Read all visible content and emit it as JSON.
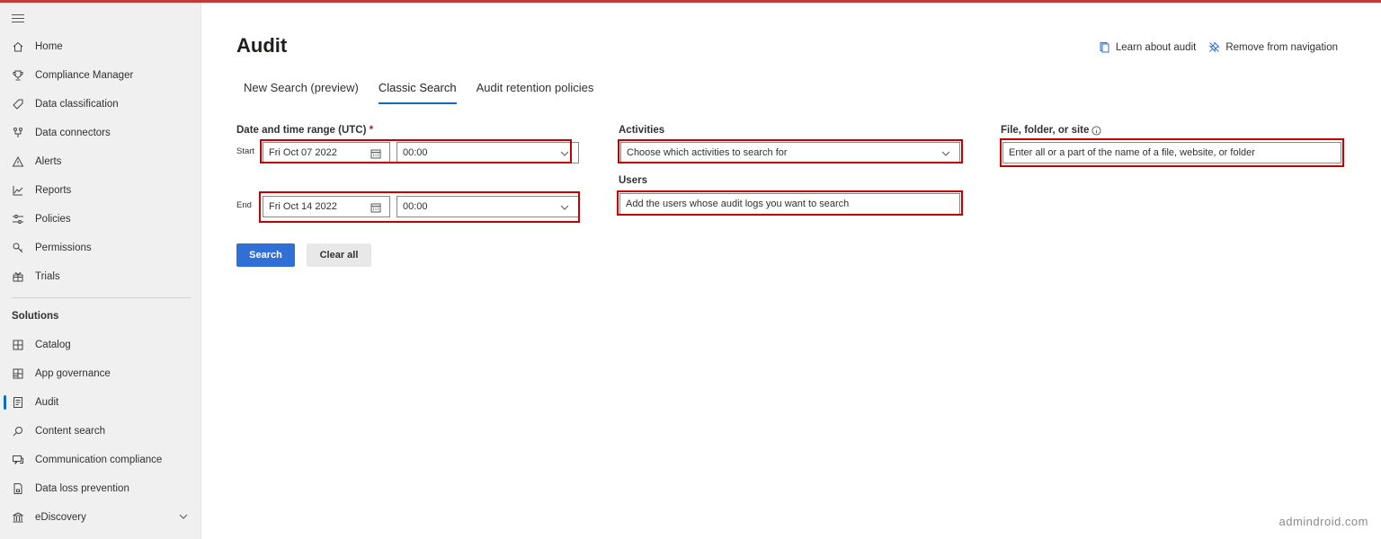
{
  "sidebar": {
    "menu_icon": "hamburger-menu-icon",
    "items": [
      {
        "label": "Home",
        "icon": "home-icon"
      },
      {
        "label": "Compliance Manager",
        "icon": "trophy-icon"
      },
      {
        "label": "Data classification",
        "icon": "tag-icon"
      },
      {
        "label": "Data connectors",
        "icon": "connector-icon"
      },
      {
        "label": "Alerts",
        "icon": "warning-icon"
      },
      {
        "label": "Reports",
        "icon": "chart-line-icon"
      },
      {
        "label": "Policies",
        "icon": "sliders-icon"
      },
      {
        "label": "Permissions",
        "icon": "key-icon"
      },
      {
        "label": "Trials",
        "icon": "gift-icon"
      }
    ],
    "section_label": "Solutions",
    "solutions": [
      {
        "label": "Catalog",
        "icon": "catalog-icon"
      },
      {
        "label": "App governance",
        "icon": "grid-icon"
      },
      {
        "label": "Audit",
        "icon": "audit-document-icon",
        "active": true
      },
      {
        "label": "Content search",
        "icon": "search-icon"
      },
      {
        "label": "Communication compliance",
        "icon": "chat-icon"
      },
      {
        "label": "Data loss prevention",
        "icon": "document-lock-icon"
      },
      {
        "label": "eDiscovery",
        "icon": "bank-icon"
      }
    ]
  },
  "header": {
    "title": "Audit",
    "learn_link": "Learn about audit",
    "remove_link": "Remove from navigation"
  },
  "tabs": [
    {
      "label": "New Search (preview)"
    },
    {
      "label": "Classic Search",
      "active": true
    },
    {
      "label": "Audit retention policies"
    }
  ],
  "form": {
    "date_range_label": "Date and time range (UTC)",
    "required_mark": "*",
    "start_label": "Start",
    "end_label": "End",
    "start_date": "Fri Oct 07 2022",
    "start_time": "00:00",
    "end_date": "Fri Oct 14 2022",
    "end_time": "00:00",
    "activities_label": "Activities",
    "activities_placeholder": "Choose which activities to search for",
    "users_label": "Users",
    "users_placeholder": "Add the users whose audit logs you want to search",
    "file_label": "File, folder, or site",
    "file_placeholder": "Enter all or a part of the name of a file, website, or folder",
    "search_button": "Search",
    "clear_button": "Clear all"
  },
  "colors": {
    "accent": "#0f6cbd",
    "primary_button": "#2f6fd6",
    "highlight_box": "#c40000"
  },
  "watermark": "admindroid.com"
}
